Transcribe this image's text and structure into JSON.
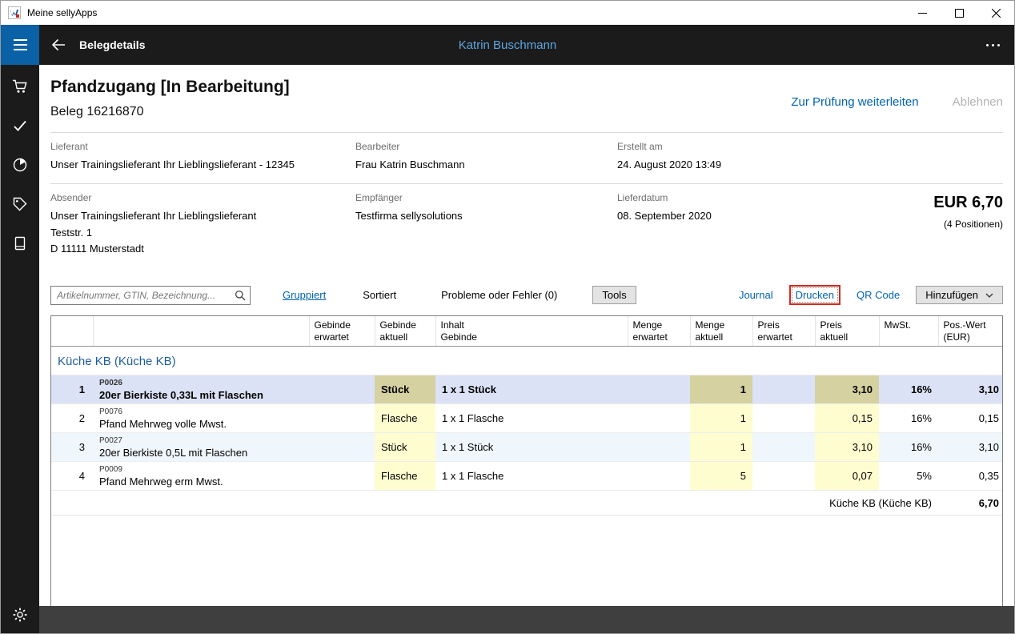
{
  "window": {
    "title": "Meine sellyApps"
  },
  "appbar": {
    "title": "Belegdetails",
    "user": "Katrin Buschmann"
  },
  "doc": {
    "title": "Pfandzugang [In Bearbeitung]",
    "number": "Beleg 16216870",
    "action_forward": "Zur Prüfung weiterleiten",
    "action_reject": "Ablehnen"
  },
  "info": {
    "lieferant_label": "Lieferant",
    "lieferant": "Unser Trainingslieferant Ihr Lieblingslieferant - 12345",
    "bearbeiter_label": "Bearbeiter",
    "bearbeiter": "Frau Katrin Buschmann",
    "erstellt_label": "Erstellt am",
    "erstellt": "24. August 2020 13:49",
    "absender_label": "Absender",
    "absender_name": "Unser Trainingslieferant Ihr Lieblingslieferant",
    "absender_street": "Teststr. 1",
    "absender_city": "D 11111 Musterstadt",
    "empfaenger_label": "Empfänger",
    "empfaenger": "Testfirma sellysolutions",
    "lieferdatum_label": "Lieferdatum",
    "lieferdatum": "08. September 2020",
    "total": "EUR 6,70",
    "positions": "(4 Positionen)"
  },
  "toolbar": {
    "search_placeholder": "Artikelnummer, GTIN, Bezeichnung...",
    "gruppiert": "Gruppiert",
    "sortiert": "Sortiert",
    "probleme": "Probleme oder Fehler (0)",
    "tools": "Tools",
    "journal": "Journal",
    "drucken": "Drucken",
    "qr_code": "QR Code",
    "hinzufuegen": "Hinzufügen"
  },
  "table": {
    "columns": [
      {
        "line1": "",
        "line2": ""
      },
      {
        "line1": "",
        "line2": ""
      },
      {
        "line1": "Gebinde",
        "line2": "erwartet"
      },
      {
        "line1": "Gebinde",
        "line2": "aktuell"
      },
      {
        "line1": "Inhalt",
        "line2": "Gebinde"
      },
      {
        "line1": "Menge",
        "line2": "erwartet"
      },
      {
        "line1": "Menge",
        "line2": "aktuell"
      },
      {
        "line1": "Preis",
        "line2": "erwartet"
      },
      {
        "line1": "Preis",
        "line2": "aktuell"
      },
      {
        "line1": "MwSt.",
        "line2": ""
      },
      {
        "line1": "Pos.-Wert",
        "line2": "(EUR)"
      }
    ],
    "group_title": "Küche KB (Küche KB)",
    "rows": [
      {
        "num": "1",
        "code": "P0026",
        "name": "20er Bierkiste 0,33L mit Flaschen",
        "gebinde_erwartet": "",
        "gebinde_aktuell": "Stück",
        "inhalt": "1 x 1 Stück",
        "menge_erwartet": "",
        "menge_aktuell": "1",
        "preis_erwartet": "",
        "preis_aktuell": "3,10",
        "mwst": "16%",
        "pos_wert": "3,10"
      },
      {
        "num": "2",
        "code": "P0076",
        "name": "Pfand Mehrweg volle Mwst.",
        "gebinde_erwartet": "",
        "gebinde_aktuell": "Flasche",
        "inhalt": "1 x 1 Flasche",
        "menge_erwartet": "",
        "menge_aktuell": "1",
        "preis_erwartet": "",
        "preis_aktuell": "0,15",
        "mwst": "16%",
        "pos_wert": "0,15"
      },
      {
        "num": "3",
        "code": "P0027",
        "name": "20er Bierkiste 0,5L mit Flaschen",
        "gebinde_erwartet": "",
        "gebinde_aktuell": "Stück",
        "inhalt": "1 x 1 Stück",
        "menge_erwartet": "",
        "menge_aktuell": "1",
        "preis_erwartet": "",
        "preis_aktuell": "3,10",
        "mwst": "16%",
        "pos_wert": "3,10"
      },
      {
        "num": "4",
        "code": "P0009",
        "name": "Pfand Mehrweg erm Mwst.",
        "gebinde_erwartet": "",
        "gebinde_aktuell": "Flasche",
        "inhalt": "1 x 1 Flasche",
        "menge_erwartet": "",
        "menge_aktuell": "5",
        "preis_erwartet": "",
        "preis_aktuell": "0,07",
        "mwst": "5%",
        "pos_wert": "0,35"
      }
    ],
    "footer": {
      "label": "Küche KB (Küche KB)",
      "total": "6,70"
    }
  }
}
